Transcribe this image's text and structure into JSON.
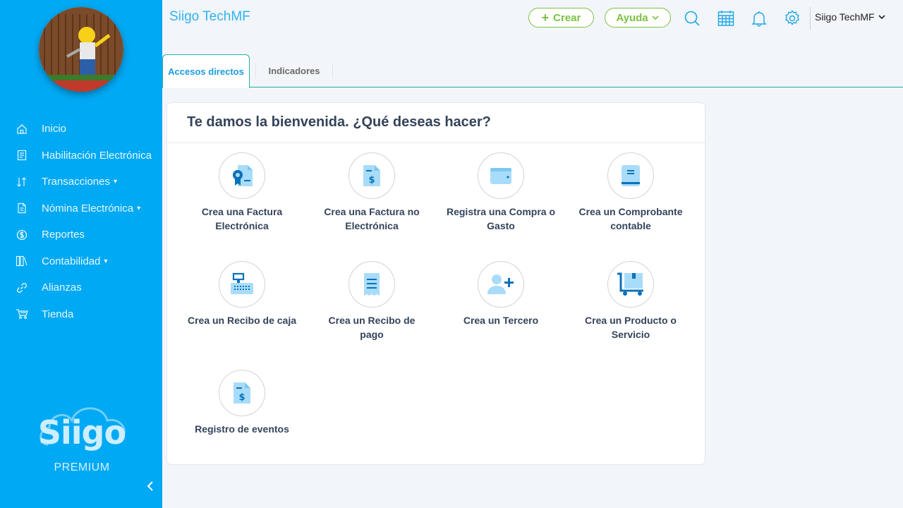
{
  "app": {
    "company_title": "Siigo TechMF"
  },
  "topbar": {
    "create_label": "Crear",
    "help_label": "Ayuda",
    "user_name": "Siigo TechMF",
    "accent": "#7cc142",
    "icon_color": "#1aa6e6"
  },
  "sidebar": {
    "background": "#00a9f4",
    "items": [
      {
        "label": "Inicio",
        "icon": "home-icon"
      },
      {
        "label": "Habilitación Electrónica",
        "icon": "document-icon"
      },
      {
        "label": "Transacciones",
        "icon": "transactions-icon",
        "expandable": true
      },
      {
        "label": "Nómina Electrónica",
        "icon": "payroll-icon",
        "expandable": true
      },
      {
        "label": "Reportes",
        "icon": "reports-icon"
      },
      {
        "label": "Contabilidad",
        "icon": "accounting-icon",
        "expandable": true
      },
      {
        "label": "Alianzas",
        "icon": "link-icon"
      },
      {
        "label": "Tienda",
        "icon": "cart-icon"
      }
    ],
    "brand_name": "Siigo",
    "brand_edition": "PREMIUM"
  },
  "tabs": [
    {
      "label": "Accesos directos",
      "active": true
    },
    {
      "label": "Indicadores",
      "active": false
    }
  ],
  "main": {
    "welcome_title": "Te damos la bienvenida. ¿Qué deseas hacer?",
    "actions": [
      {
        "label": "Crea una Factura Electrónica",
        "icon": "electronic-invoice-icon"
      },
      {
        "label": "Crea una Factura no Electrónica",
        "icon": "invoice-icon"
      },
      {
        "label": "Registra una Compra o Gasto",
        "icon": "wallet-icon"
      },
      {
        "label": "Crea un Comprobante contable",
        "icon": "ledger-book-icon"
      },
      {
        "label": "Crea un Recibo de caja",
        "icon": "cash-register-icon"
      },
      {
        "label": "Crea un Recibo de pago",
        "icon": "receipt-icon"
      },
      {
        "label": "Crea un Tercero",
        "icon": "add-person-icon"
      },
      {
        "label": "Crea un Producto o Servicio",
        "icon": "product-cart-icon"
      },
      {
        "label": "Registro de eventos",
        "icon": "event-log-icon"
      }
    ]
  }
}
